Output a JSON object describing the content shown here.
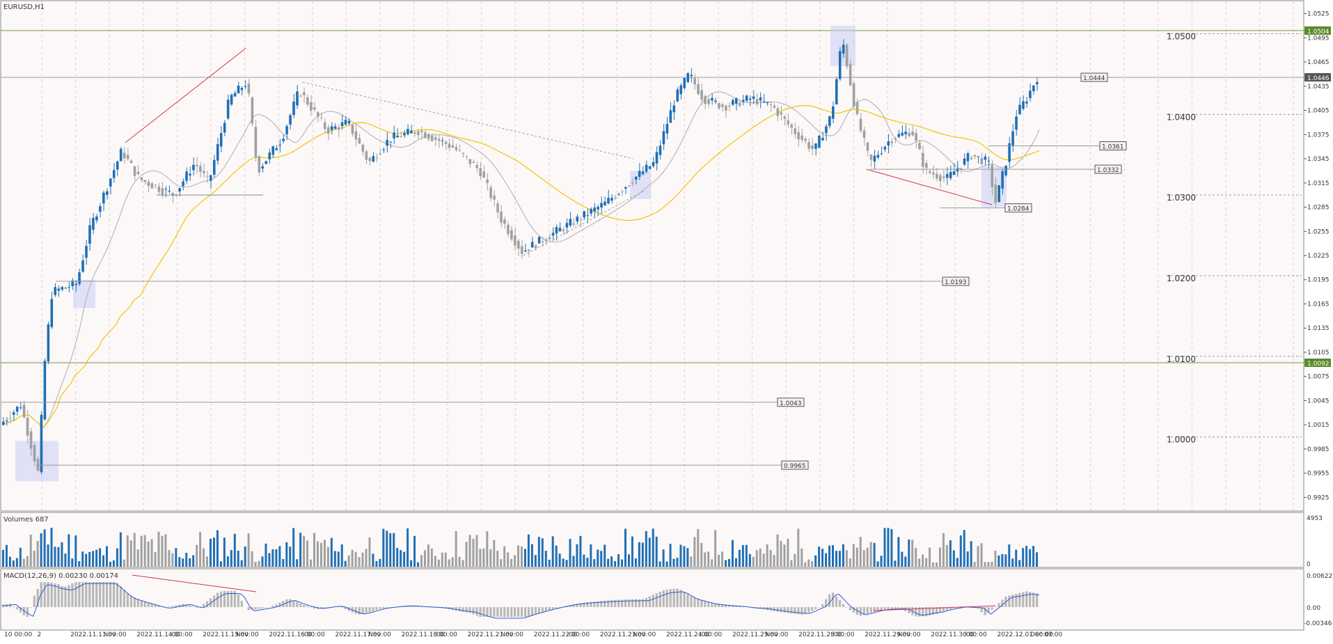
{
  "chart_data": {
    "type": "candlestick",
    "symbol_label": "EURUSD,H1",
    "price_axis": {
      "ylim": [
        0.9915,
        1.0535
      ],
      "ticks": [
        "1.0525",
        "1.0495",
        "1.0465",
        "1.0435",
        "1.0405",
        "1.0375",
        "1.0345",
        "1.0315",
        "1.0285",
        "1.0255",
        "1.0225",
        "1.0195",
        "1.0165",
        "1.0135",
        "1.0105",
        "1.0075",
        "1.0045",
        "1.0015",
        "0.9985",
        "0.9955",
        "0.9925"
      ],
      "current_price": "1.0446",
      "level_tags": [
        {
          "label": "1.0504",
          "value": 1.0504,
          "color": "#5a8a2a"
        },
        {
          "label": "1.0092",
          "value": 1.0092,
          "color": "#5a8a2a"
        }
      ]
    },
    "horizontal_levels": [
      {
        "value": 1.0504,
        "color": "#6b9a3a"
      },
      {
        "value": 1.0446,
        "color": "#9a9a9a"
      },
      {
        "value": 1.0092,
        "color": "#6b9a3a"
      }
    ],
    "round_levels": [
      {
        "label": "1.0500",
        "value": 1.05
      },
      {
        "label": "1.0400",
        "value": 1.04
      },
      {
        "label": "1.0300",
        "value": 1.03
      },
      {
        "label": "1.0200",
        "value": 1.02
      },
      {
        "label": "1.0100",
        "value": 1.01
      },
      {
        "label": "1.0000",
        "value": 1.0
      }
    ],
    "price_labels": [
      {
        "label": "1.0444",
        "value": 1.0446
      },
      {
        "label": "1.0361",
        "value": 1.0361
      },
      {
        "label": "1.0332",
        "value": 1.0332
      },
      {
        "label": "1.0284",
        "value": 1.0284
      },
      {
        "label": "1.0193",
        "value": 1.0193
      },
      {
        "label": "1.0043",
        "value": 1.0043
      },
      {
        "label": "0.9965",
        "value": 0.9965
      }
    ],
    "time_axis": {
      "ticks": [
        "10 00:00",
        "2",
        "2022.11.11 00:00",
        "Nov",
        "2022.11.14 00:00",
        ":00",
        "2022.11.15 00:00",
        "Nov",
        "2022.11.16 00:00",
        ":00",
        "2022.11.17 00:00",
        "Nov",
        "2022.11.18 00:00",
        ":00",
        "2022.11.21 00:00",
        "Nov",
        "2022.11.22 00:00",
        ":00",
        "2022.11.23 00:00",
        "Nov",
        "2022.11.24 00:00",
        ":00",
        "2022.11.25 00:00",
        "Nov",
        "2022.11.28 00:00",
        ":00",
        "2022.11.29 00:00",
        "Nov",
        "2022.11.30 00:00",
        ":00",
        "2022.12.01 00:00",
        "Dec 07:00"
      ]
    },
    "volumes": {
      "label": "Volumes 687",
      "ticks": [
        "4953",
        "0"
      ]
    },
    "macd": {
      "label": "MACD(12,26,9) 0.00230 0.00174",
      "ticks": [
        "0.00622",
        "0.00",
        "-0.00346"
      ]
    },
    "colors": {
      "bull": "#1f6fb5",
      "bear": "#a0a0a0",
      "ma_slow": "#f2c400",
      "ma_fast": "#b8b8b8",
      "trend_red": "#d0305a",
      "background": "#fcf8f8",
      "grid": "#d8d4d4"
    }
  }
}
